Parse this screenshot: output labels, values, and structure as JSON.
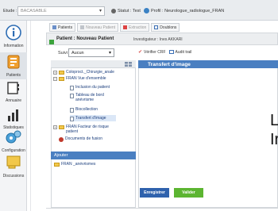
{
  "topbar": {
    "etude_label": "Etude :",
    "etude_value": "BACASABLE",
    "statut_label": "Statut : Test",
    "profil_label": "Profil : Neurologue_radiologue_FRAN"
  },
  "appbar": {
    "items": [
      {
        "label": "Information",
        "icon": "info-icon"
      },
      {
        "label": "Patients",
        "icon": "patients-icon"
      },
      {
        "label": "Annuaire",
        "icon": "book-icon"
      },
      {
        "label": "Statistiques",
        "icon": "statistics-icon"
      },
      {
        "label": "Configuration",
        "icon": "config-icon"
      },
      {
        "label": "Discussions",
        "icon": "discussion-icon"
      }
    ]
  },
  "tabs": [
    {
      "label": "Patients",
      "disabled": false
    },
    {
      "label": "Nouveau Patient",
      "disabled": true
    },
    {
      "label": "Extraction",
      "disabled": true
    },
    {
      "label": "Doublons",
      "disabled": false
    }
  ],
  "patient": {
    "title": "Patient : Nouveau Patient",
    "investigator": "Investigateur : Ines AKKARI"
  },
  "suivi": {
    "label": "Suivi",
    "value": "Aucun"
  },
  "toolbar": {
    "verifier": "Vérifier CRF",
    "audit": "Audit trail"
  },
  "tree": {
    "items": [
      {
        "label": "Coloproct._Chirurgie_anale",
        "type": "folder"
      },
      {
        "label": "FRAN Vue d'ensemble",
        "type": "folder"
      },
      {
        "label": "Inclusion du patient",
        "type": "doc"
      },
      {
        "label": "Tableau de bord anévrisme",
        "type": "doc"
      },
      {
        "label": "Biocollection",
        "type": "doc"
      },
      {
        "label": "Transfert d'image",
        "type": "doc"
      },
      {
        "label": "FRAN Facteur de risque patient",
        "type": "folder"
      },
      {
        "label": "Documents de fusion",
        "type": "special"
      }
    ],
    "ajouter_label": "Ajouter",
    "ajouter_item": "FRAN _anévrismes"
  },
  "main": {
    "title": "Transfert d'image",
    "cutoff_text_1": "L",
    "cutoff_text_2": "Ir"
  },
  "buttons": {
    "enregistrer": "Enregistrer",
    "valider": "Valider"
  },
  "colors": {
    "accent": "#4a7fc1",
    "save": "#2f62ad",
    "validate": "#5cb531"
  }
}
